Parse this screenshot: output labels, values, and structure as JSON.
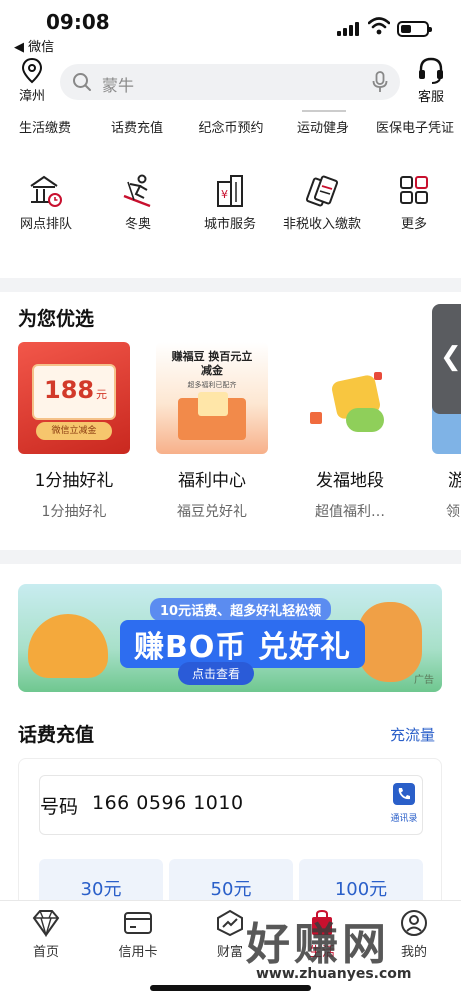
{
  "status_bar": {
    "time": "09:08",
    "back_app": "◀ 微信"
  },
  "header": {
    "location_label": "漳州",
    "search_placeholder": "蒙牛",
    "service_label": "客服"
  },
  "quick_row": [
    {
      "label": "生活缴费"
    },
    {
      "label": "话费充值"
    },
    {
      "label": "纪念币预约"
    },
    {
      "label": "运动健身"
    },
    {
      "label": "医保电子凭证"
    }
  ],
  "service_grid": [
    {
      "label": "网点排队",
      "icon": "bank-queue-icon"
    },
    {
      "label": "冬奥",
      "icon": "skier-icon"
    },
    {
      "label": "城市服务",
      "icon": "city-building-icon"
    },
    {
      "label": "非税收入缴款",
      "icon": "tax-ticket-icon"
    },
    {
      "label": "更多",
      "icon": "grid-more-icon"
    }
  ],
  "picks": {
    "title": "为您优选",
    "items": [
      {
        "title": "1分抽好礼",
        "subtitle": "1分抽好礼",
        "image_text": "188",
        "image_unit": "元",
        "image_caption": "微信立减金",
        "bg": "#e8463a"
      },
      {
        "title": "福利中心",
        "subtitle": "福豆兑好礼",
        "image_text": "赚福豆 换百元立减金",
        "image_caption": "超多福利已配齐",
        "bg": "#fdf1e6"
      },
      {
        "title": "发福地段",
        "subtitle": "超值福利…",
        "bg": "#ffffff"
      },
      {
        "title": "游",
        "subtitle": "领",
        "bg": "#7fb3e6"
      }
    ],
    "collapse_glyph": "❮"
  },
  "banner": {
    "subtitle": "10元话费、超多好礼轻松领",
    "main": "赚BO币 兑好礼",
    "button": "点击查看",
    "ad_tag": "广告"
  },
  "recharge": {
    "title": "话费充值",
    "link": "充流量",
    "phone_label": "号码",
    "phone_value": "166 0596 1010",
    "contacts_label": "通讯录",
    "amounts": [
      "30元",
      "50元",
      "100元"
    ]
  },
  "tabbar": [
    {
      "label": "首页",
      "icon": "diamond-home-icon"
    },
    {
      "label": "信用卡",
      "icon": "credit-card-icon"
    },
    {
      "label": "财富",
      "icon": "wealth-chart-icon"
    },
    {
      "label": "生活",
      "icon": "shopping-bag-icon"
    },
    {
      "label": "我的",
      "icon": "user-profile-icon"
    }
  ],
  "watermark": {
    "main": "好赚网",
    "url": "www.zhuanyes.com"
  },
  "colors": {
    "accent_blue": "#2a5fc9",
    "brand_red": "#c8102e"
  }
}
